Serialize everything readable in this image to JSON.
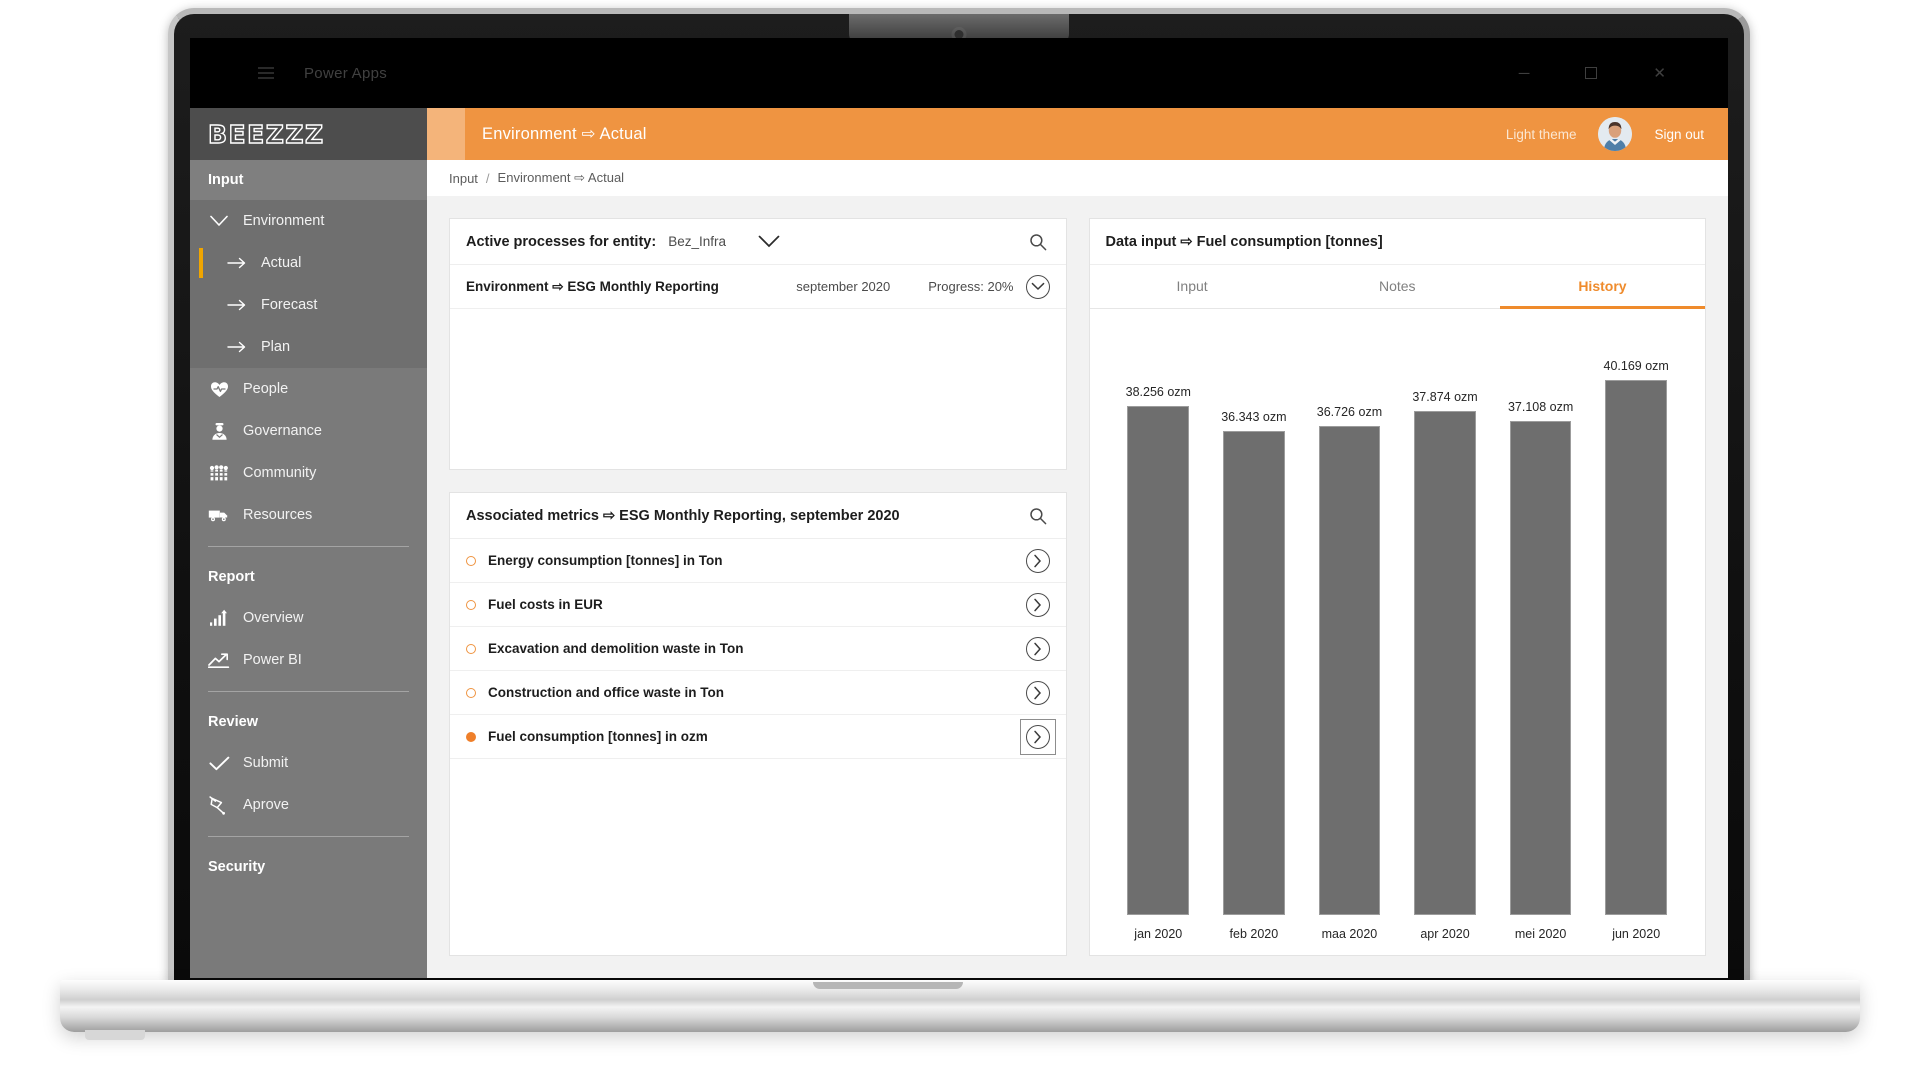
{
  "browser": {
    "app_name": "Power Apps",
    "window_controls": [
      "minimize",
      "maximize",
      "close"
    ]
  },
  "sidebar": {
    "brand": "BEEZZZ",
    "sections": [
      {
        "title": "Input",
        "items": [
          {
            "label": "Environment",
            "icon": "chevron-down-icon",
            "active": false,
            "sub": false
          },
          {
            "label": "Actual",
            "icon": "arrow-right-icon",
            "active": true,
            "sub": true
          },
          {
            "label": "Forecast",
            "icon": "arrow-right-icon",
            "active": false,
            "sub": true
          },
          {
            "label": "Plan",
            "icon": "arrow-right-icon",
            "active": false,
            "sub": true
          },
          {
            "label": "People",
            "icon": "heart-people-icon",
            "active": false,
            "sub": false
          },
          {
            "label": "Governance",
            "icon": "governance-icon",
            "active": false,
            "sub": false
          },
          {
            "label": "Community",
            "icon": "community-icon",
            "active": false,
            "sub": false
          },
          {
            "label": "Resources",
            "icon": "truck-icon",
            "active": false,
            "sub": false
          }
        ]
      },
      {
        "title": "Report",
        "items": [
          {
            "label": "Overview",
            "icon": "bar-chart-icon",
            "active": false,
            "sub": false
          },
          {
            "label": "Power BI",
            "icon": "line-chart-icon",
            "active": false,
            "sub": false
          }
        ]
      },
      {
        "title": "Review",
        "items": [
          {
            "label": "Submit",
            "icon": "check-icon",
            "active": false,
            "sub": false
          },
          {
            "label": "Aprove",
            "icon": "pen-nib-icon",
            "active": false,
            "sub": false
          }
        ]
      },
      {
        "title": "Security",
        "items": []
      }
    ]
  },
  "topbar": {
    "title": "Environment ⇨ Actual",
    "light_theme_label": "Light theme",
    "sign_out_label": "Sign out"
  },
  "breadcrumb": {
    "root": "Input",
    "separator": "/",
    "current": "Environment ⇨ Actual"
  },
  "active_processes": {
    "title": "Active processes for entity:",
    "entity": "Bez_Infra",
    "rows": [
      {
        "name": "Environment ⇨ ESG Monthly Reporting",
        "period": "september 2020",
        "progress": "Progress: 20%"
      }
    ]
  },
  "associated_metrics": {
    "title": "Associated metrics ⇨ ESG Monthly Reporting, september 2020",
    "items": [
      {
        "label": "Energy consumption [tonnes] in Ton",
        "selected": false,
        "focused": false
      },
      {
        "label": "Fuel costs in EUR",
        "selected": false,
        "focused": false
      },
      {
        "label": "Excavation and demolition waste in Ton",
        "selected": false,
        "focused": false
      },
      {
        "label": "Construction and office waste in Ton",
        "selected": false,
        "focused": false
      },
      {
        "label": "Fuel consumption [tonnes] in ozm",
        "selected": true,
        "focused": true
      }
    ]
  },
  "data_input": {
    "title": "Data input ⇨ Fuel consumption [tonnes]",
    "tabs": [
      {
        "label": "Input",
        "active": false
      },
      {
        "label": "Notes",
        "active": false
      },
      {
        "label": "History",
        "active": true
      }
    ]
  },
  "colors": {
    "accent": "#ef9441",
    "accent_active": "#ef8b2c",
    "dot_filled": "#ef7f2a",
    "sidebar": "#7a7a7a",
    "sidebar_brand": "#4d4d4d",
    "bar": "#6e6e6e",
    "active_marker": "#f0a500"
  },
  "chart_data": {
    "type": "bar",
    "title": "Data input ⇨ Fuel consumption [tonnes]",
    "xlabel": "",
    "ylabel": "",
    "unit": "ozm",
    "grid": false,
    "legend": "none",
    "categories": [
      "jan 2020",
      "feb 2020",
      "maa 2020",
      "apr 2020",
      "mei 2020",
      "jun 2020"
    ],
    "values": [
      38.256,
      36.343,
      36.726,
      37.874,
      37.108,
      40.169
    ],
    "data_labels": [
      "38.256 ozm",
      "36.343 ozm",
      "36.726 ozm",
      "37.874 ozm",
      "37.108 ozm",
      "40.169 ozm"
    ],
    "ylim": [
      0,
      44
    ]
  }
}
